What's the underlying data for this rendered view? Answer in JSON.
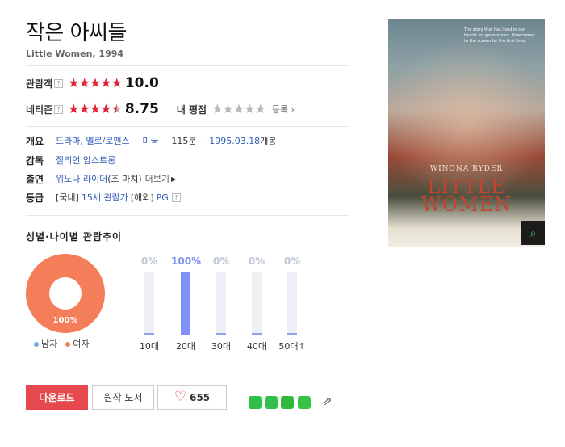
{
  "movie": {
    "title": "작은 아씨들",
    "subtitle": "Little Women, 1994"
  },
  "ratings": {
    "audience": {
      "label": "관람객",
      "help": "?",
      "stars": 5,
      "score": "10.0"
    },
    "netizen": {
      "label": "네티즌",
      "help": "?",
      "stars": 4.5,
      "score": "8.75"
    },
    "my_rating": {
      "label": "내 평점",
      "register": "등록"
    }
  },
  "info": {
    "overview": {
      "label": "개요",
      "genre": "드라마, 멜로/로맨스",
      "country": "미국",
      "runtime": "115분",
      "release": "1995.03.18",
      "release_suffix": "개봉"
    },
    "director": {
      "label": "감독",
      "name": "질리언 암스트롱"
    },
    "cast": {
      "label": "출연",
      "name": "위노나 라이더",
      "role": "(조 마치)",
      "more": "더보기"
    },
    "grade": {
      "label": "등급",
      "domestic": "[국내]",
      "domestic_grade": "15세 관람가",
      "foreign": "[해외]",
      "foreign_grade": "PG",
      "help": "?"
    }
  },
  "demographics": {
    "title": "성별·나이별 관람추이",
    "gender": {
      "female_percent": 100,
      "pie_label": "100%",
      "male_label": "남자",
      "female_label": "여자",
      "male_color": "#6ea6e8",
      "female_color": "#f47e5a"
    },
    "age_groups": [
      {
        "label": "10대",
        "percent_text": "0%",
        "value": 0
      },
      {
        "label": "20대",
        "percent_text": "100%",
        "value": 100
      },
      {
        "label": "30대",
        "percent_text": "0%",
        "value": 0
      },
      {
        "label": "40대",
        "percent_text": "0%",
        "value": 0
      },
      {
        "label": "50대↑",
        "percent_text": "0%",
        "value": 0
      }
    ]
  },
  "actions": {
    "download": "다운로드",
    "original_book": "원작 도서",
    "likes": "655"
  },
  "poster": {
    "tagline": "The story that has lived in our hearts for generations. Now comes to the screen for the first time.",
    "star_name": "WINONA RYDER",
    "film_title": "LITTLE WOMEN"
  },
  "icons": {
    "share": [
      "line-share-icon",
      "kakaotalk-share-icon",
      "band-share-icon",
      "note-share-icon"
    ],
    "share_more": "share-arrow-icon",
    "zoom": "magnifier-icon"
  }
}
